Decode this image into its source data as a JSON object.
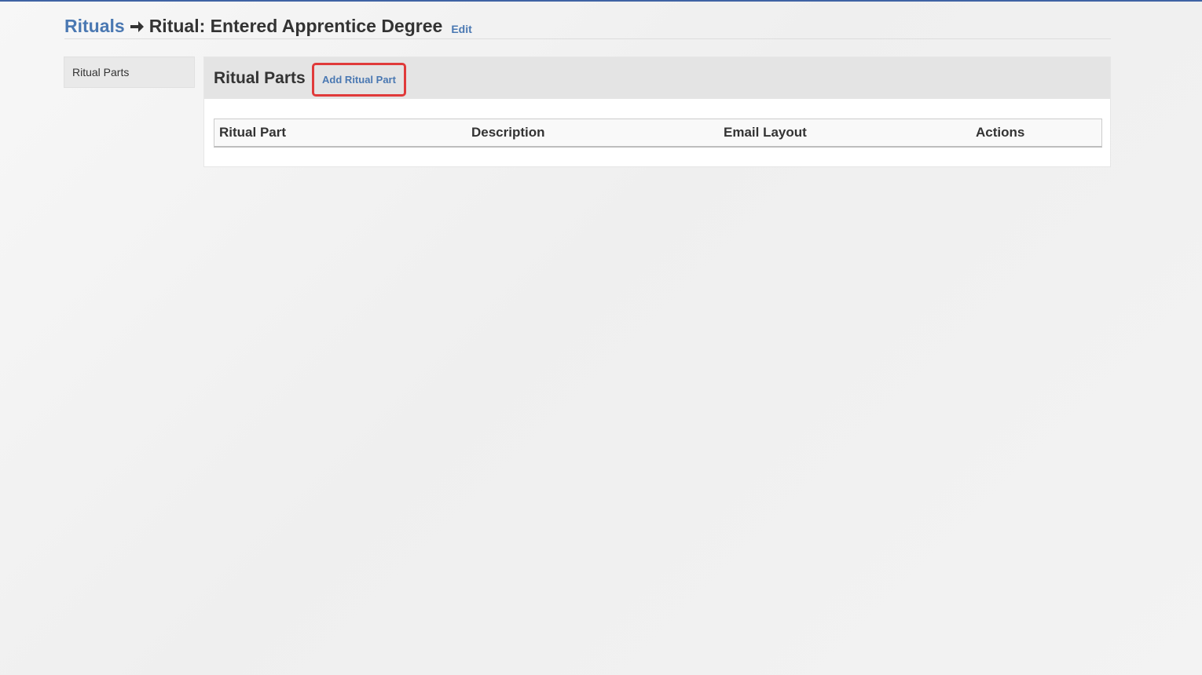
{
  "header": {
    "breadcrumb_root": "Rituals",
    "title": "Ritual: Entered Apprentice Degree",
    "edit_label": "Edit",
    "breadcrumb_separator_icon": "arrow-right-icon"
  },
  "sidebar": {
    "items": [
      {
        "label": "Ritual Parts"
      }
    ]
  },
  "panel": {
    "title": "Ritual Parts",
    "add_label": "Add Ritual Part",
    "highlight_color": "#e03a3a"
  },
  "table": {
    "columns": [
      "Ritual Part",
      "Description",
      "Email Layout",
      "Actions"
    ],
    "rows": []
  },
  "colors": {
    "link": "#4a78b2",
    "top_strip": "#3f63a4",
    "heading_bg": "#e4e4e4"
  }
}
